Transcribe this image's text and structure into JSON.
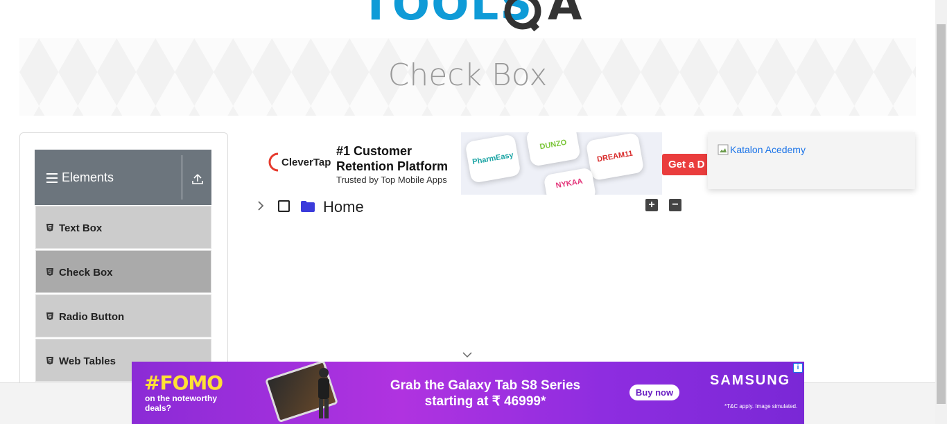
{
  "logo": {
    "left": "TOOLS",
    "right": "QA"
  },
  "banner": {
    "title": "Check Box"
  },
  "sidebar": {
    "group": {
      "label": "Elements",
      "icon": "menu-icon",
      "collapse_icon": "upload-icon"
    },
    "items": [
      {
        "label": "Text Box",
        "icon": "html5-icon",
        "active": false
      },
      {
        "label": "Check Box",
        "icon": "html5-icon",
        "active": true
      },
      {
        "label": "Radio Button",
        "icon": "html5-icon",
        "active": false
      },
      {
        "label": "Web Tables",
        "icon": "html5-icon",
        "active": false
      }
    ]
  },
  "tree": {
    "node_label": "Home",
    "expand_all": "+",
    "collapse_all": "−"
  },
  "ad_top": {
    "brand": "CleverTap",
    "headline_line1": "#1 Customer",
    "headline_line2": "Retention Platform",
    "subline": "Trusted by Top Mobile Apps",
    "tiles": [
      "PharmEasy",
      "DUNZO",
      "DREAM11",
      "NYKAA"
    ],
    "cta": "Get a D"
  },
  "ad_right": {
    "alt_text": "Katalon Acedemy"
  },
  "ad_bottom": {
    "fomo": "#FOMO",
    "fomo_sub": "on the noteworthy deals?",
    "line1": "Grab the Galaxy Tab S8 Series",
    "line2": "starting at ₹ 46999*",
    "buy": "Buy now",
    "brand": "SAMSUNG",
    "tnc": "*T&C apply. Image simulated.",
    "info": "i"
  },
  "colors": {
    "accent_blue": "#0f9bd7",
    "sidebar_header": "#6c757d",
    "menu_item": "#cccccc",
    "menu_item_active": "#aaaaaa",
    "folder": "#3b3bdb",
    "cta_red": "#ea3d3d"
  }
}
